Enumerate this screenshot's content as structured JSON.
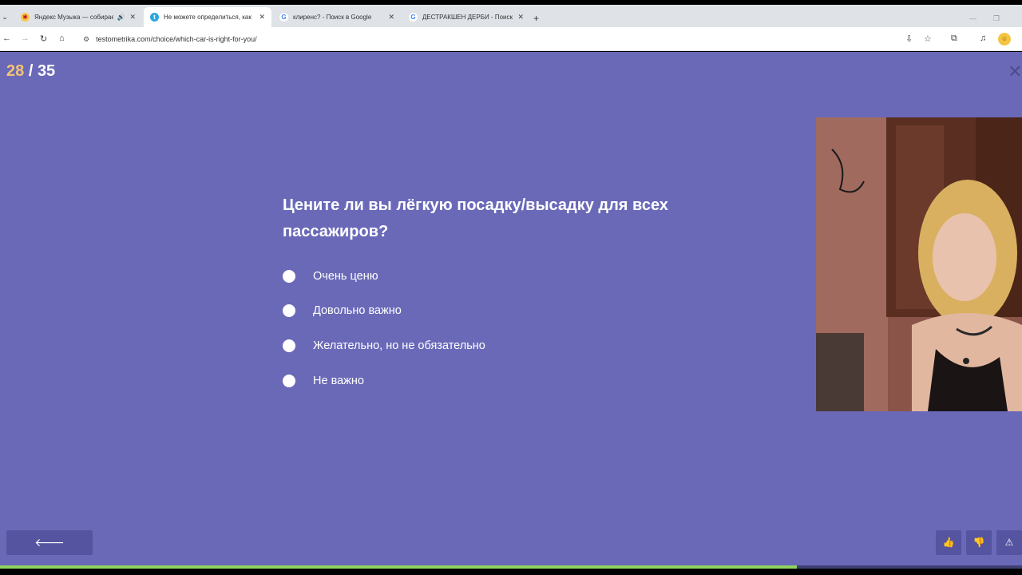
{
  "browser": {
    "tabs": [
      {
        "title": "Яндекс Музыка — собирае",
        "audio": "🔊",
        "active": false
      },
      {
        "title": "Не можете определиться, как",
        "active": true
      },
      {
        "title": "клиренс? - Поиск в Google",
        "active": false
      },
      {
        "title": "ДЕСТРАКШЕН ДЕРБИ - Поиск",
        "active": false
      }
    ],
    "url": "testometrika.com/choice/which-car-is-right-for-you/"
  },
  "quiz": {
    "current": "28",
    "separator": "/",
    "total": "35",
    "question": "Цените ли вы лёгкую посадку/высадку для всех пассажиров?",
    "options": [
      "Очень ценю",
      "Довольно важно",
      "Желательно, но не обязательно",
      "Не важно"
    ],
    "progress_fraction": 0.78
  },
  "colors": {
    "page_bg": "#6a69b8",
    "counter_current": "#f5c471",
    "progress": "#8fd45f"
  },
  "icons": {
    "back": "arrow-left-icon",
    "like": "thumbs-up-icon",
    "dislike": "thumbs-down-icon",
    "report": "warning-icon",
    "close": "close-icon"
  }
}
